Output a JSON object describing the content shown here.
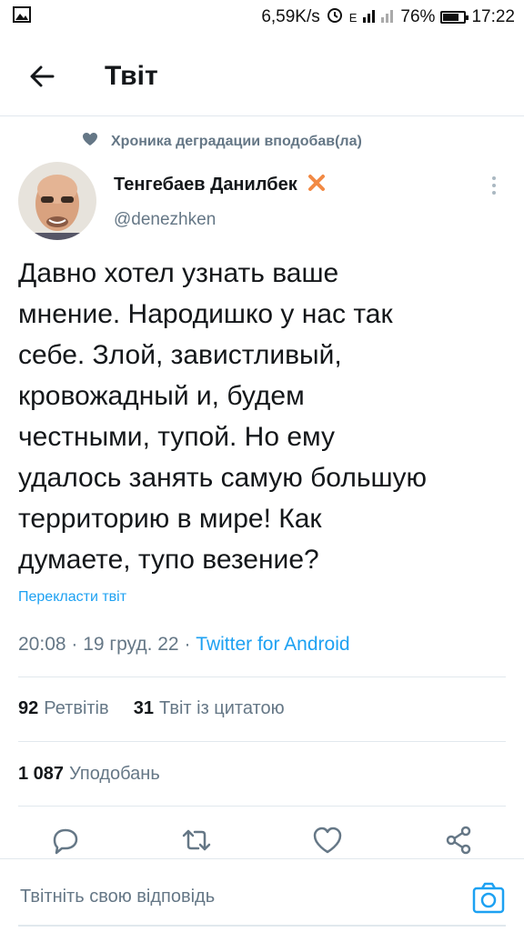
{
  "status_bar": {
    "speed": "6,59K/s",
    "network": "E",
    "battery_level": 0.76,
    "battery_text": "76%",
    "time": "17:22"
  },
  "header": {
    "title": "Твіт"
  },
  "social_context": {
    "text": "Хроника деградации вподобав(ла)",
    "icon": "heart-icon"
  },
  "author": {
    "name": "Тенгебаев Данилбек",
    "handle": "@denezhken",
    "badge_icon": "x-badge-icon",
    "badge_color": "#f28a45"
  },
  "tweet": {
    "lines": [
      "Давно хотел узнать ваше",
      "мнение. Народишко у нас так",
      "себе. Злой, завистливый,",
      "кровожадный и, будем",
      "честными, тупой. Но ему",
      "удалось занять самую большую",
      "территорию в мире! Как",
      "думаете, тупо везение?"
    ],
    "translate_label": "Перекласти твіт",
    "time": "20:08",
    "date": "19 груд. 22",
    "client": "Twitter for Android"
  },
  "stats": {
    "retweets_count": "92",
    "retweets_label": "Ретвітів",
    "quotes_count": "31",
    "quotes_label": "Твіт із цитатою",
    "likes_count": "1 087",
    "likes_label": "Уподобань"
  },
  "reply": {
    "placeholder": "Твітніть свою відповідь"
  },
  "colors": {
    "accent": "#1da1f2",
    "muted": "#657786",
    "divider": "#e1e8ed"
  }
}
